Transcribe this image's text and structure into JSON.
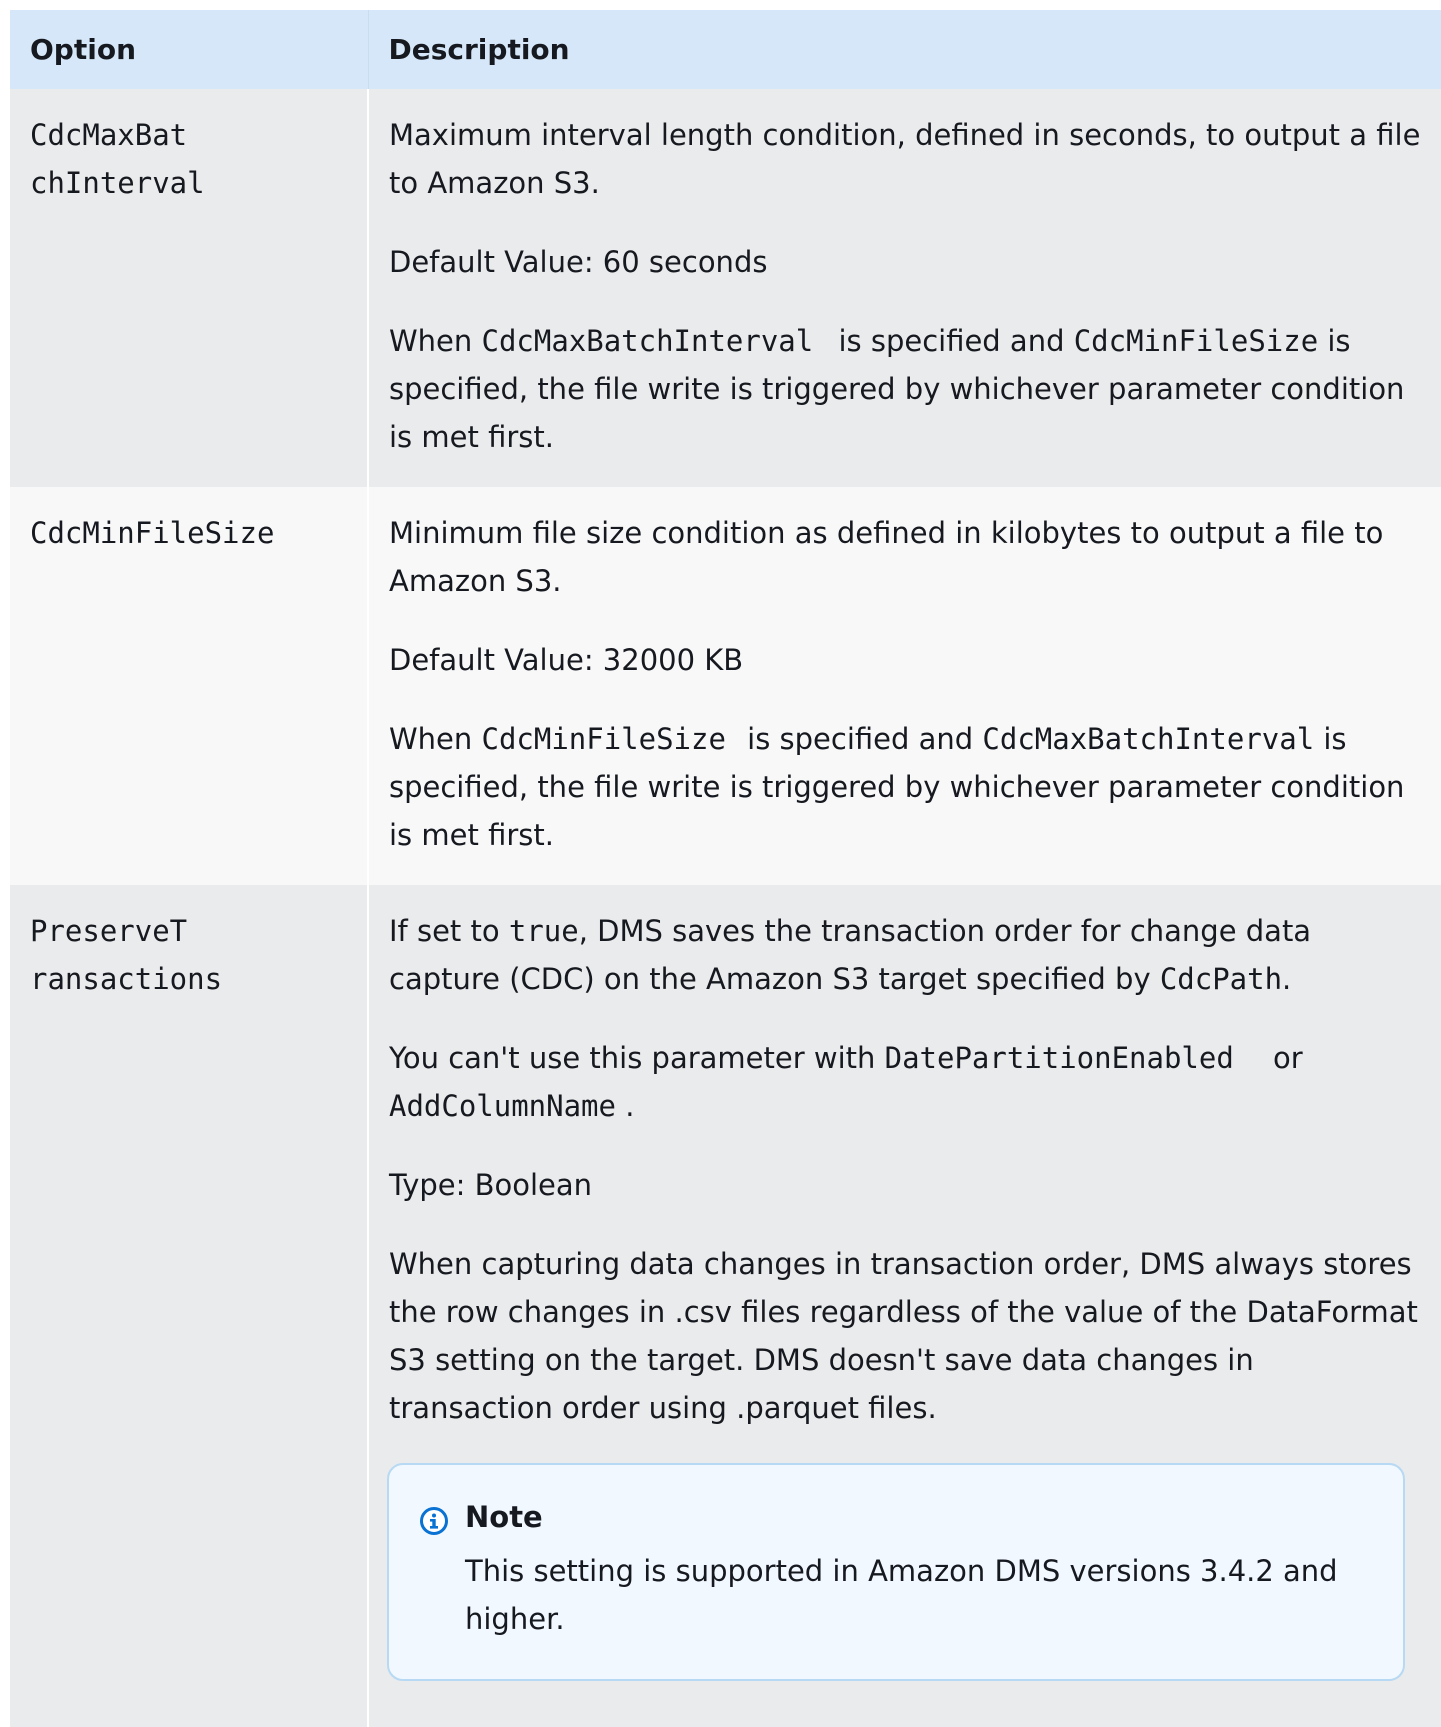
{
  "table": {
    "headers": [
      "Option",
      "Description"
    ],
    "rows": [
      {
        "option_line1": "CdcMaxBat",
        "option_line2": "chInterval",
        "desc1": "Maximum interval length condition, defined in seconds, to output a file to Amazon S3.",
        "desc2": "Default Value: 60 seconds",
        "desc3": {
          "t1": "When ",
          "c1": "CdcMaxBatchInterval",
          "t2": " is specified and ",
          "c2": "CdcMinFileSize",
          "t3": " is specified, the file write is triggered by whichever parameter condition is met first."
        }
      },
      {
        "option_line1": "CdcMinFileSize",
        "desc1": "Minimum file size condition as defined in kilobytes to output a file to Amazon S3.",
        "desc2": "Default Value: 32000 KB",
        "desc3": {
          "t1": "When ",
          "c1": "CdcMinFileSize",
          "t2": " is specified and ",
          "c2": "CdcMaxBatchInterval",
          "t3": " is specified, the file write is triggered by whichever parameter condition is met first."
        }
      },
      {
        "option_line1": "PreserveT",
        "option_line2": "ransactions",
        "desc1": {
          "t1": "If set to ",
          "c1": "true",
          "t2": ", DMS saves the transaction order for change data capture (CDC) on the Amazon S3 target specified by ",
          "c2": "CdcPath",
          "t3": "."
        },
        "desc2": {
          "t1": "You can't use this parameter with ",
          "c1": "DatePartitionEnabled",
          "t2": " or ",
          "c2": "AddColumnName",
          "t3": " ."
        },
        "desc3": "Type: Boolean",
        "desc4": "When capturing data changes in transaction order, DMS always stores the row changes in .csv files regardless of the value of the DataFormat S3 setting on the target. DMS doesn't save data changes in transaction order using .parquet files.",
        "note": {
          "icon": "info-icon",
          "title": "Note",
          "body": "This setting is supported in Amazon DMS versions 3.4.2 and higher."
        }
      }
    ]
  }
}
